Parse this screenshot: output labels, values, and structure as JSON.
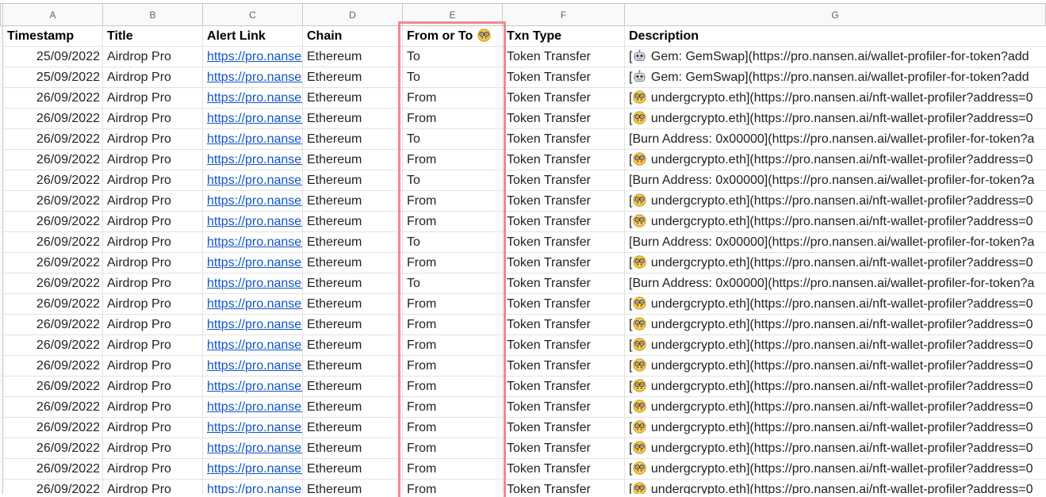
{
  "column_letters": [
    "A",
    "B",
    "C",
    "D",
    "E",
    "F",
    "G"
  ],
  "headers": [
    "Timestamp",
    "Title",
    "Alert Link",
    "Chain",
    "From or To",
    "Txn Type",
    "Description"
  ],
  "header_icon": "nerd-face-icon",
  "rows": [
    {
      "ts": "25/09/2022",
      "title": "Airdrop Pro",
      "link": "https://pro.nansen.ai",
      "chain": "Ethereum",
      "dir": "To",
      "txn": "Token Transfer",
      "icon": "robot-icon",
      "desc": " Gem: GemSwap](https://pro.nansen.ai/wallet-profiler-for-token?add"
    },
    {
      "ts": "25/09/2022",
      "title": "Airdrop Pro",
      "link": "https://pro.nansen.ai",
      "chain": "Ethereum",
      "dir": "To",
      "txn": "Token Transfer",
      "icon": "robot-icon",
      "desc": " Gem: GemSwap](https://pro.nansen.ai/wallet-profiler-for-token?add"
    },
    {
      "ts": "26/09/2022",
      "title": "Airdrop Pro",
      "link": "https://pro.nansen.ai",
      "chain": "Ethereum",
      "dir": "From",
      "txn": "Token Transfer",
      "icon": "nerd-face-icon",
      "desc": " undergcrypto.eth](https://pro.nansen.ai/nft-wallet-profiler?address=0"
    },
    {
      "ts": "26/09/2022",
      "title": "Airdrop Pro",
      "link": "https://pro.nansen.ai",
      "chain": "Ethereum",
      "dir": "From",
      "txn": "Token Transfer",
      "icon": "nerd-face-icon",
      "desc": " undergcrypto.eth](https://pro.nansen.ai/nft-wallet-profiler?address=0"
    },
    {
      "ts": "26/09/2022",
      "title": "Airdrop Pro",
      "link": "https://pro.nansen.ai",
      "chain": "Ethereum",
      "dir": "To",
      "txn": "Token Transfer",
      "icon": "",
      "desc": "Burn Address: 0x00000](https://pro.nansen.ai/wallet-profiler-for-token?a"
    },
    {
      "ts": "26/09/2022",
      "title": "Airdrop Pro",
      "link": "https://pro.nansen.ai",
      "chain": "Ethereum",
      "dir": "From",
      "txn": "Token Transfer",
      "icon": "nerd-face-icon",
      "desc": " undergcrypto.eth](https://pro.nansen.ai/nft-wallet-profiler?address=0"
    },
    {
      "ts": "26/09/2022",
      "title": "Airdrop Pro",
      "link": "https://pro.nansen.ai",
      "chain": "Ethereum",
      "dir": "To",
      "txn": "Token Transfer",
      "icon": "",
      "desc": "Burn Address: 0x00000](https://pro.nansen.ai/wallet-profiler-for-token?a"
    },
    {
      "ts": "26/09/2022",
      "title": "Airdrop Pro",
      "link": "https://pro.nansen.ai",
      "chain": "Ethereum",
      "dir": "From",
      "txn": "Token Transfer",
      "icon": "nerd-face-icon",
      "desc": " undergcrypto.eth](https://pro.nansen.ai/nft-wallet-profiler?address=0"
    },
    {
      "ts": "26/09/2022",
      "title": "Airdrop Pro",
      "link": "https://pro.nansen.ai",
      "chain": "Ethereum",
      "dir": "From",
      "txn": "Token Transfer",
      "icon": "nerd-face-icon",
      "desc": " undergcrypto.eth](https://pro.nansen.ai/nft-wallet-profiler?address=0"
    },
    {
      "ts": "26/09/2022",
      "title": "Airdrop Pro",
      "link": "https://pro.nansen.ai",
      "chain": "Ethereum",
      "dir": "To",
      "txn": "Token Transfer",
      "icon": "",
      "desc": "Burn Address: 0x00000](https://pro.nansen.ai/wallet-profiler-for-token?a"
    },
    {
      "ts": "26/09/2022",
      "title": "Airdrop Pro",
      "link": "https://pro.nansen.ai",
      "chain": "Ethereum",
      "dir": "From",
      "txn": "Token Transfer",
      "icon": "nerd-face-icon",
      "desc": " undergcrypto.eth](https://pro.nansen.ai/nft-wallet-profiler?address=0"
    },
    {
      "ts": "26/09/2022",
      "title": "Airdrop Pro",
      "link": "https://pro.nansen.ai",
      "chain": "Ethereum",
      "dir": "To",
      "txn": "Token Transfer",
      "icon": "",
      "desc": "Burn Address: 0x00000](https://pro.nansen.ai/wallet-profiler-for-token?a"
    },
    {
      "ts": "26/09/2022",
      "title": "Airdrop Pro",
      "link": "https://pro.nansen.ai",
      "chain": "Ethereum",
      "dir": "From",
      "txn": "Token Transfer",
      "icon": "nerd-face-icon",
      "desc": " undergcrypto.eth](https://pro.nansen.ai/nft-wallet-profiler?address=0"
    },
    {
      "ts": "26/09/2022",
      "title": "Airdrop Pro",
      "link": "https://pro.nansen.ai",
      "chain": "Ethereum",
      "dir": "From",
      "txn": "Token Transfer",
      "icon": "nerd-face-icon",
      "desc": " undergcrypto.eth](https://pro.nansen.ai/nft-wallet-profiler?address=0"
    },
    {
      "ts": "26/09/2022",
      "title": "Airdrop Pro",
      "link": "https://pro.nansen.ai",
      "chain": "Ethereum",
      "dir": "From",
      "txn": "Token Transfer",
      "icon": "nerd-face-icon",
      "desc": " undergcrypto.eth](https://pro.nansen.ai/nft-wallet-profiler?address=0"
    },
    {
      "ts": "26/09/2022",
      "title": "Airdrop Pro",
      "link": "https://pro.nansen.ai",
      "chain": "Ethereum",
      "dir": "From",
      "txn": "Token Transfer",
      "icon": "nerd-face-icon",
      "desc": " undergcrypto.eth](https://pro.nansen.ai/nft-wallet-profiler?address=0"
    },
    {
      "ts": "26/09/2022",
      "title": "Airdrop Pro",
      "link": "https://pro.nansen.ai",
      "chain": "Ethereum",
      "dir": "From",
      "txn": "Token Transfer",
      "icon": "nerd-face-icon",
      "desc": " undergcrypto.eth](https://pro.nansen.ai/nft-wallet-profiler?address=0"
    },
    {
      "ts": "26/09/2022",
      "title": "Airdrop Pro",
      "link": "https://pro.nansen.ai",
      "chain": "Ethereum",
      "dir": "From",
      "txn": "Token Transfer",
      "icon": "nerd-face-icon",
      "desc": " undergcrypto.eth](https://pro.nansen.ai/nft-wallet-profiler?address=0"
    },
    {
      "ts": "26/09/2022",
      "title": "Airdrop Pro",
      "link": "https://pro.nansen.ai",
      "chain": "Ethereum",
      "dir": "From",
      "txn": "Token Transfer",
      "icon": "nerd-face-icon",
      "desc": " undergcrypto.eth](https://pro.nansen.ai/nft-wallet-profiler?address=0"
    },
    {
      "ts": "26/09/2022",
      "title": "Airdrop Pro",
      "link": "https://pro.nansen.ai",
      "chain": "Ethereum",
      "dir": "From",
      "txn": "Token Transfer",
      "icon": "nerd-face-icon",
      "desc": " undergcrypto.eth](https://pro.nansen.ai/nft-wallet-profiler?address=0"
    },
    {
      "ts": "26/09/2022",
      "title": "Airdrop Pro",
      "link": "https://pro.nansen.ai",
      "chain": "Ethereum",
      "dir": "From",
      "txn": "Token Transfer",
      "icon": "nerd-face-icon",
      "desc": " undergcrypto.eth](https://pro.nansen.ai/nft-wallet-profiler?address=0"
    },
    {
      "ts": "26/09/2022",
      "title": "Airdrop Pro",
      "link": "https://pro.nansen.ai",
      "chain": "Ethereum",
      "dir": "From",
      "txn": "Token Transfer",
      "icon": "nerd-face-icon",
      "desc": " undergcrypto.eth](https://pro.nansen.ai/nft-wallet-profiler?address=0"
    }
  ],
  "colors": {
    "highlight_border": "#f08a8f",
    "link": "#1155cc",
    "header_bg": "#f8f9fa",
    "grid_line": "#e2e2e2"
  }
}
